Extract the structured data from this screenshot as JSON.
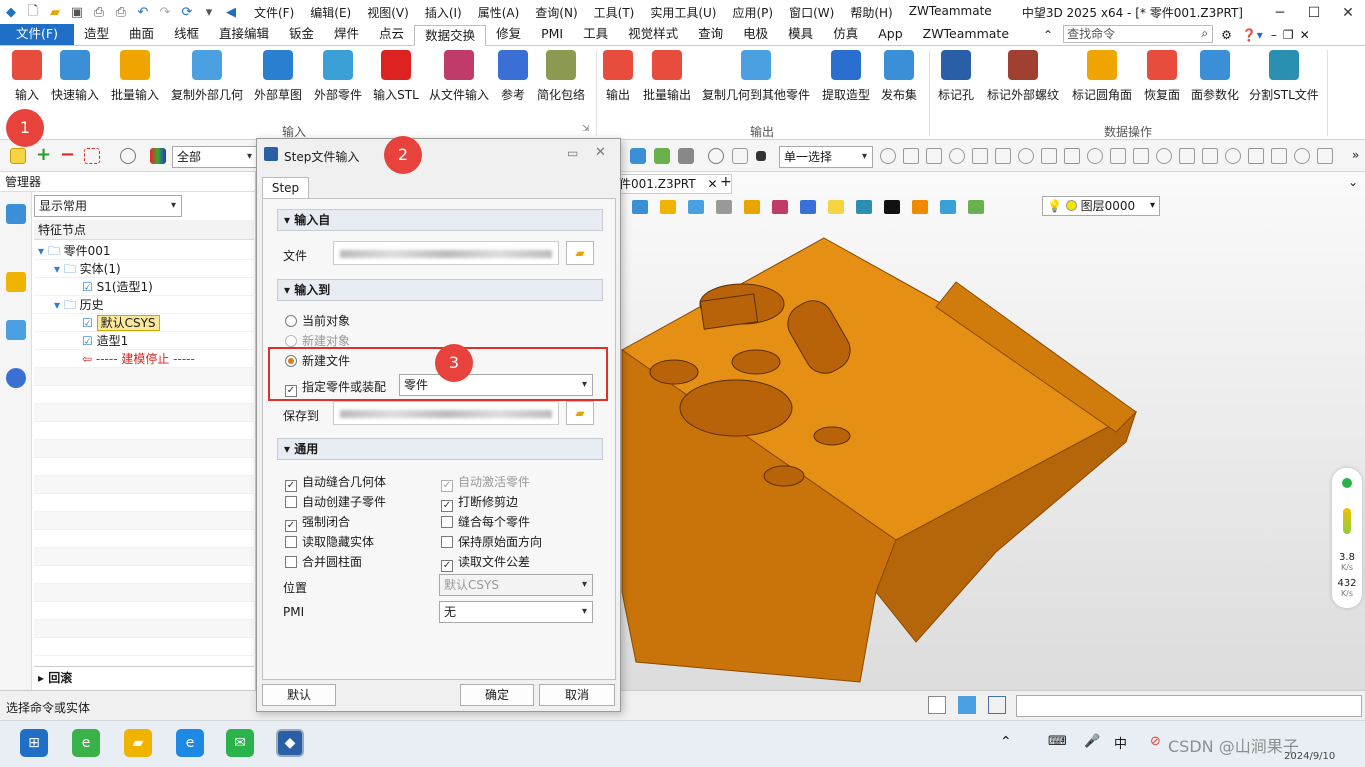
{
  "window": {
    "title": "中望3D 2025 x64 - [* 零件001.Z3PRT]"
  },
  "menus": [
    "文件(F)",
    "编辑(E)",
    "视图(V)",
    "插入(I)",
    "属性(A)",
    "查询(N)",
    "工具(T)",
    "实用工具(U)",
    "应用(P)",
    "窗口(W)",
    "帮助(H)",
    "ZWTeammate"
  ],
  "ribbon_tabs": [
    "文件(F)",
    "造型",
    "曲面",
    "线框",
    "直接编辑",
    "钣金",
    "焊件",
    "点云",
    "数据交换",
    "修复",
    "PMI",
    "工具",
    "视觉样式",
    "查询",
    "电极",
    "模具",
    "仿真",
    "App",
    "ZWTeammate"
  ],
  "search": {
    "placeholder": "查找命令"
  },
  "ribbon": {
    "input_buttons": [
      "输入",
      "快速输入",
      "批量输入",
      "复制外部几何",
      "外部草图",
      "外部零件",
      "输入STL",
      "从文件输入",
      "参考",
      "简化包络"
    ],
    "output_buttons": [
      "输出",
      "批量输出",
      "复制几何到其他零件",
      "提取造型",
      "发布集"
    ],
    "dataop_buttons": [
      "标记孔",
      "标记外部螺纹",
      "标记圆角面",
      "恢复面",
      "面参数化",
      "分割STL文件"
    ],
    "groups": {
      "input": "输入",
      "output": "输出",
      "dataop": "数据操作"
    }
  },
  "filter": {
    "value": "全部"
  },
  "select_mode": {
    "value": "单一选择"
  },
  "layer": {
    "value": "图层0000"
  },
  "doc_tab": {
    "label": "件001.Z3PRT"
  },
  "manager": {
    "title": "管理器",
    "display_filter": "显示常用",
    "column": "特征节点",
    "rollback": "回滚"
  },
  "tree": [
    "零件001",
    "实体(1)",
    "S1(造型1)",
    "历史",
    "默认CSYS",
    "造型1",
    "----- 建模停止 -----"
  ],
  "dialog": {
    "title": "Step文件输入",
    "tab": "Step",
    "section_from": "输入自",
    "file_label": "文件",
    "section_to": "输入到",
    "radio_current": "当前对象",
    "radio_new_obj": "新建对象",
    "radio_new_file": "新建文件",
    "assign_label": "指定零件或装配",
    "assign_value": "零件",
    "save_label": "保存到",
    "section_general": "通用",
    "opts_left": [
      "自动缝合几何体",
      "自动创建子零件",
      "强制闭合",
      "读取隐藏实体",
      "合并圆柱面"
    ],
    "opts_right": [
      "自动激活零件",
      "打断修剪边",
      "缝合每个零件",
      "保持原始面方向",
      "读取文件公差"
    ],
    "position_label": "位置",
    "position_value": "默认CSYS",
    "pmi_label": "PMI",
    "pmi_value": "无",
    "btn_default": "默认",
    "btn_ok": "确定",
    "btn_cancel": "取消"
  },
  "badges": [
    "1",
    "2",
    "3"
  ],
  "status": {
    "text": "选择命令或实体"
  },
  "speed": {
    "up": "3.8",
    "up_unit": "K/s",
    "down": "432",
    "down_unit": "K/s"
  },
  "taskbar": {
    "date": "2024/9/10"
  },
  "watermark": "CSDN @山涧果子",
  "colors": {
    "accent": "#1e6fc5",
    "part": "#e08a10",
    "badge": "#e8423c"
  }
}
